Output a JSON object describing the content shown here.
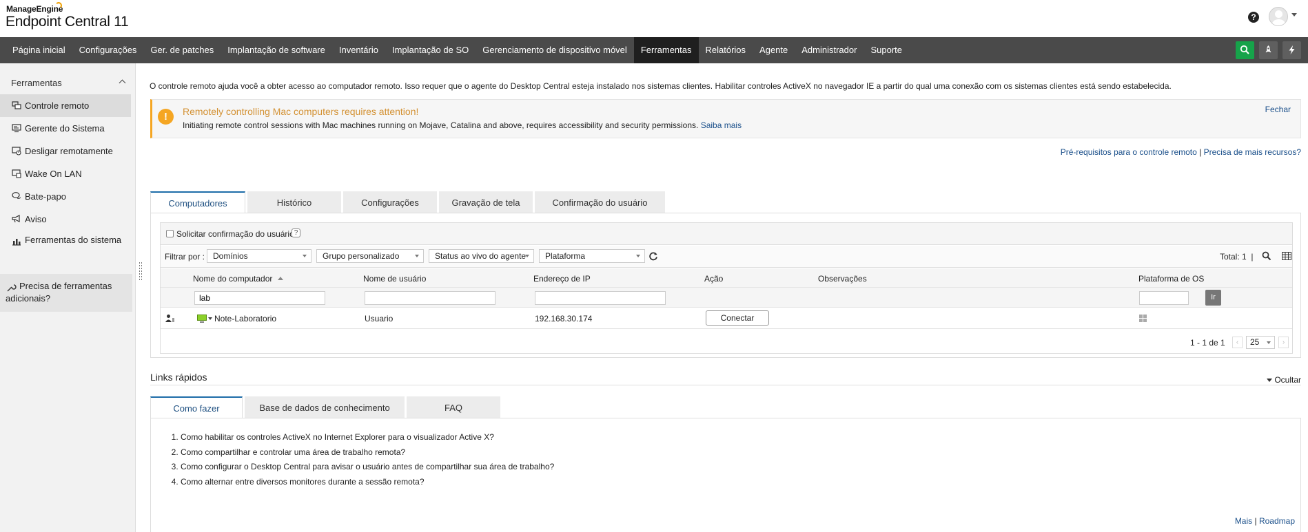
{
  "header": {
    "brand_small": "ManageEngine",
    "brand_big": "Endpoint Central 11",
    "help_glyph": "?"
  },
  "nav": {
    "items": [
      "Página inicial",
      "Configurações",
      "Ger. de patches",
      "Implantação de software",
      "Inventário",
      "Implantação de SO",
      "Gerenciamento de dispositivo móvel",
      "Ferramentas",
      "Relatórios",
      "Agente",
      "Administrador",
      "Suporte"
    ],
    "active": "Ferramentas",
    "icons": [
      "search-icon",
      "rocket-icon",
      "bolt-icon"
    ],
    "search_color": "#16a34a"
  },
  "sidebar": {
    "title": "Ferramentas",
    "items": [
      {
        "label": "Controle remoto",
        "icon": "remote-control-icon"
      },
      {
        "label": "Gerente do Sistema",
        "icon": "system-manager-icon"
      },
      {
        "label": "Desligar remotamente",
        "icon": "shutdown-icon"
      },
      {
        "label": "Wake On LAN",
        "icon": "wake-on-lan-icon"
      },
      {
        "label": "Bate-papo",
        "icon": "chat-icon"
      },
      {
        "label": "Aviso",
        "icon": "megaphone-icon"
      },
      {
        "label": "Ferramentas do sistema",
        "icon": "system-tools-icon"
      }
    ],
    "help": "Precisa de ferramentas adicionais?"
  },
  "main": {
    "intro": "O controle remoto ajuda você a obter acesso ao computador remoto. Isso requer que o agente do Desktop Central esteja instalado nos sistemas clientes. Habilitar controles ActiveX no navegador IE a partir do qual uma conexão com os sistemas clientes está sendo estabelecida.",
    "alert": {
      "title": "Remotely controlling Mac computers requires attention!",
      "text": "Initiating remote control sessions with Mac machines running on Mojave, Catalina and above, requires accessibility and security permissions.",
      "link": "Saiba mais",
      "close": "Fechar",
      "color": "#f5a623"
    },
    "prereq_link": "Pré-requisitos para o controle remoto",
    "separator": "|",
    "more_resources_link": "Precisa de mais recursos?",
    "tabs": [
      "Computadores",
      "Histórico",
      "Configurações",
      "Gravação de tela",
      "Confirmação do usuário"
    ],
    "active_tab": "Computadores",
    "confirm_label": "Solicitar confirmação do usuário",
    "filter": {
      "label": "Filtrar por :",
      "selects": [
        "Domínios",
        "Grupo personalizado",
        "Status ao vivo do agente",
        "Plataforma"
      ],
      "total": "Total: 1",
      "total_sep": "|"
    },
    "columns": [
      "Nome do computador",
      "Nome de usuário",
      "Endereço de IP",
      "Ação",
      "Observações",
      "Plataforma de OS"
    ],
    "search_values": {
      "computer": "lab",
      "user": "",
      "ip": "",
      "os": ""
    },
    "go_label": "Ir",
    "rows": [
      {
        "computer": "Note-Laboratorio",
        "user": "Usuario",
        "ip": "192.168.30.174",
        "action": "Conectar",
        "os_icon": "windows-icon"
      }
    ],
    "pager": {
      "range": "1 - 1 de 1",
      "per_page": "25"
    }
  },
  "quick_links": {
    "title": "Links rápidos",
    "hide": "Ocultar",
    "tabs": [
      "Como fazer",
      "Base de dados de conhecimento",
      "FAQ"
    ],
    "active_tab": "Como fazer",
    "items": [
      "Como habilitar os controles ActiveX no Internet Explorer para o visualizador Active X?",
      "Como compartilhar e controlar uma área de trabalho remota?",
      "Como configurar o Desktop Central para avisar o usuário antes de compartilhar sua área de trabalho?",
      "Como alternar entre diversos monitores durante a sessão remota?"
    ],
    "footer_more": "Mais",
    "footer_sep": "|",
    "footer_roadmap": "Roadmap"
  }
}
